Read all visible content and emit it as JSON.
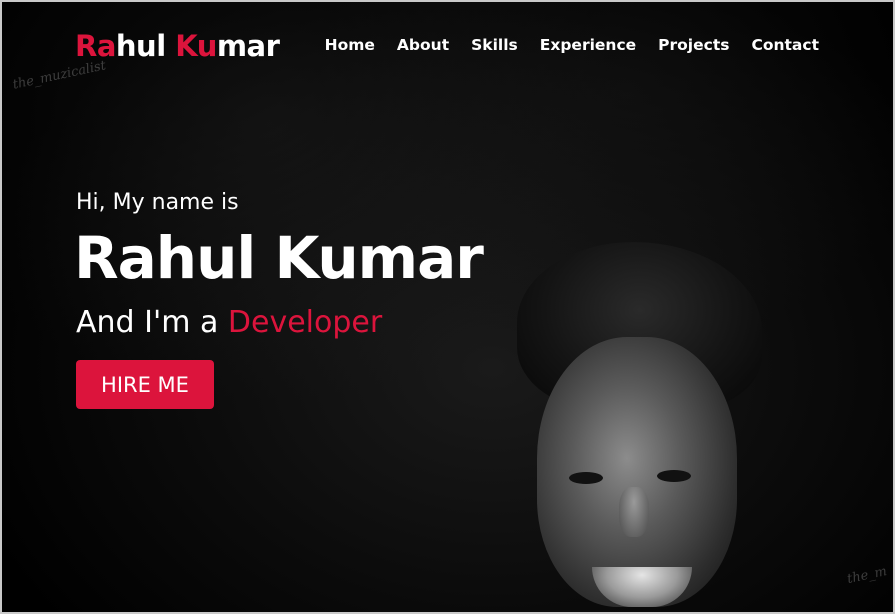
{
  "navbar": {
    "logo": {
      "part1_accent": "Ra",
      "part2": "hul ",
      "part3_accent": "Ku",
      "part4": "mar"
    },
    "links": [
      "Home",
      "About",
      "Skills",
      "Experience",
      "Projects",
      "Contact"
    ]
  },
  "hero": {
    "greeting": "Hi, My name is",
    "name": "Rahul Kumar",
    "role_prefix": "And I'm a ",
    "role": "Developer",
    "cta_label": "HIRE ME"
  },
  "watermarks": {
    "top": "the_muzicalist",
    "bottom": "the_m"
  },
  "colors": {
    "accent": "#dc143c",
    "background": "#000000",
    "text": "#ffffff"
  }
}
